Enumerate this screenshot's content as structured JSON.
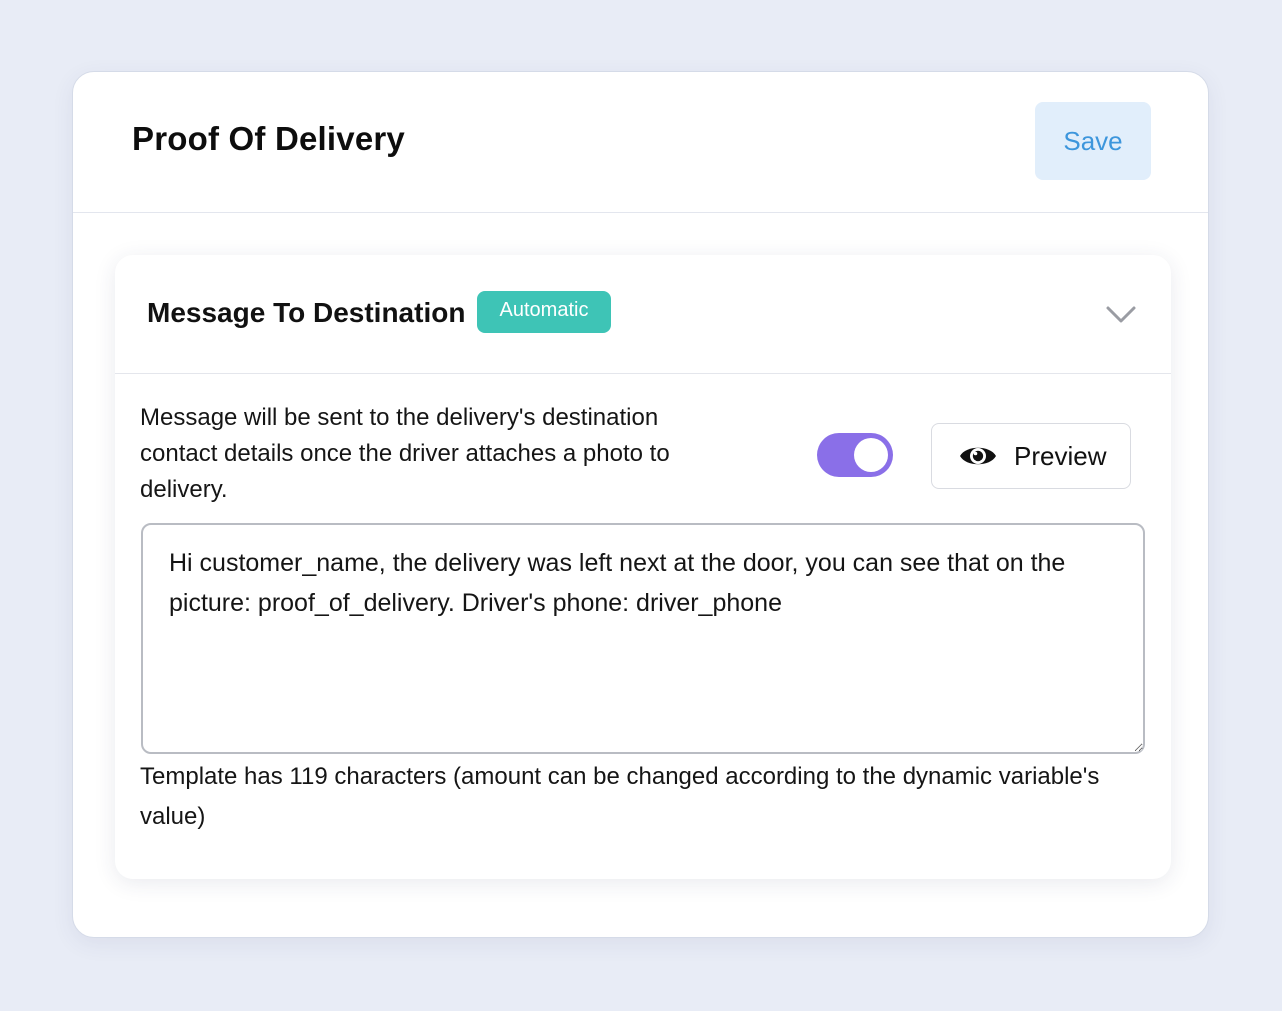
{
  "page": {
    "title": "Proof Of Delivery",
    "save_label": "Save"
  },
  "card": {
    "title": "Message To Destination",
    "badge": "Automatic",
    "description": "Message will be sent to the delivery's destination contact details once the driver attaches a photo to delivery.",
    "toggle_on": true,
    "preview_label": "Preview",
    "message_text": "Hi customer_name, the delivery was left next at the door, you can see that on the picture: proof_of_delivery. Driver's phone: driver_phone",
    "char_count_text": "Template has 119 characters (amount can be changed according to the dynamic variable's value)"
  },
  "icons": {
    "chevron": "chevron-down-icon",
    "eye": "eye-icon"
  },
  "colors": {
    "background": "#e8ecf6",
    "save_bg": "#e1eefb",
    "save_text": "#3d96dc",
    "badge_bg": "#3ec4b6",
    "toggle_on": "#8a6fe8"
  }
}
